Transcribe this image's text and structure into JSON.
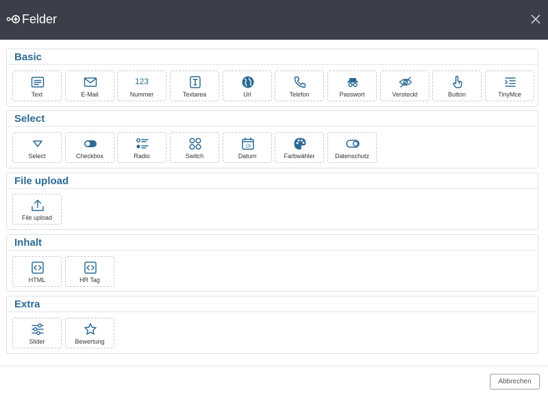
{
  "dialog": {
    "title": "Felder",
    "close_icon": "close-icon",
    "logo_icon": "forms-logo-icon"
  },
  "sections": {
    "basic": {
      "title": "Basic",
      "items": {
        "text": "Text",
        "email": "E-Mail",
        "nummer": "Nummer",
        "nummer_glyph": "123",
        "textarea": "Textarea",
        "url": "Url",
        "telefon": "Telefon",
        "passwort": "Passwort",
        "versteckt": "Versteckt",
        "button": "Button",
        "tinymce": "TinyMce"
      }
    },
    "select": {
      "title": "Select",
      "items": {
        "select": "Select",
        "checkbox": "Checkbox",
        "radio": "Radio",
        "switch": "Switch",
        "datum": "Datum",
        "datum_glyph": "19",
        "farbwaehler": "Farbwähler",
        "datenschutz": "Datenschutz"
      }
    },
    "file_upload": {
      "title": "File upload",
      "items": {
        "file_upload": "File upload"
      }
    },
    "inhalt": {
      "title": "Inhalt",
      "items": {
        "html": "HTML",
        "hr_tag": "HR Tag"
      }
    },
    "extra": {
      "title": "Extra",
      "items": {
        "slider": "Slider",
        "bewertung": "Bewertung"
      }
    }
  },
  "footer": {
    "cancel_label": "Abbrechen"
  },
  "colors": {
    "header_bg": "#3b3f4a",
    "accent": "#2b6a94",
    "border": "#dcdfe4"
  }
}
